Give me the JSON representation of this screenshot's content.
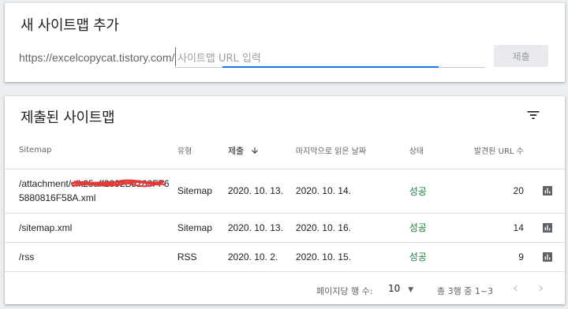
{
  "add_card": {
    "title": "새 사이트맵 추가",
    "url_prefix": "https://excelcopycat.tistory.com/",
    "input_placeholder": "사이트맵 URL 입력",
    "input_value": "",
    "submit_label": "제출"
  },
  "list_card": {
    "title": "제출된 사이트맵",
    "filter_icon": "filter-icon",
    "columns": {
      "sitemap": "Sitemap",
      "type": "유형",
      "submitted": "제출",
      "last_read": "마지막으로 읽은 날짜",
      "status": "상태",
      "discovered": "발견된 URL 수"
    },
    "sort_icon": "arrow-down-icon",
    "rows": [
      {
        "sitemap_line1": "/attachment/cfk25aff2892B5280FF6",
        "sitemap_line2": "5880816F58A.xml",
        "type": "Sitemap",
        "submitted": "2020. 10. 13.",
        "last_read": "2020. 10. 14.",
        "status": "성공",
        "discovered": "20"
      },
      {
        "sitemap_line1": "/sitemap.xml",
        "type": "Sitemap",
        "submitted": "2020. 10. 13.",
        "last_read": "2020. 10. 16.",
        "status": "성공",
        "discovered": "14"
      },
      {
        "sitemap_line1": "/rss",
        "type": "RSS",
        "submitted": "2020. 10. 2.",
        "last_read": "2020. 10. 15.",
        "status": "성공",
        "discovered": "9"
      }
    ],
    "pagination": {
      "rows_per_page_label": "페이지당 행 수:",
      "rows_per_page_value": "10",
      "range_text": "총 3행 중 1~3"
    }
  },
  "colors": {
    "accent": "#1a73e8",
    "success": "#188038",
    "redaction": "#e53935",
    "icon": "#5f6368"
  }
}
